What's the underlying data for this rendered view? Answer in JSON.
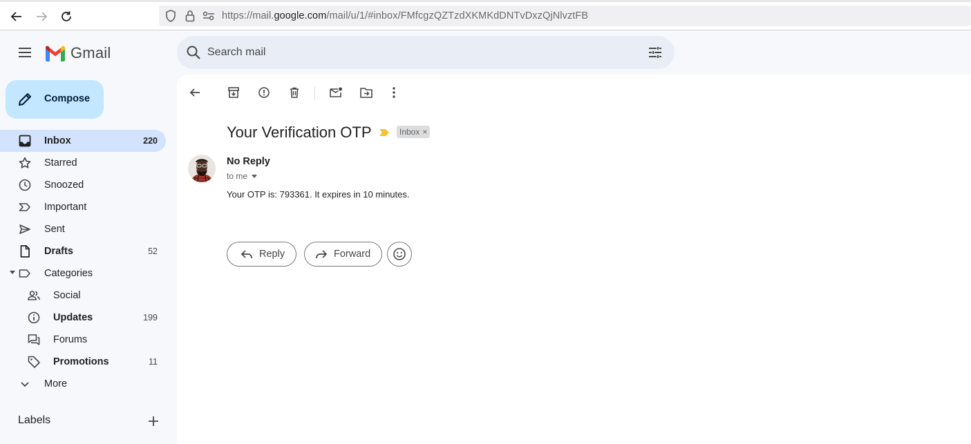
{
  "browser": {
    "url_prefix": "https://mail.",
    "url_host": "google.com",
    "url_path": "/mail/u/1/#inbox/FMfcgzQZTzdXKMKdDNTvDxzQjNlvztFB"
  },
  "app": {
    "name": "Gmail",
    "search_placeholder": "Search mail"
  },
  "sidebar": {
    "compose_label": "Compose",
    "items": [
      {
        "label": "Inbox",
        "count": "220"
      },
      {
        "label": "Starred",
        "count": ""
      },
      {
        "label": "Snoozed",
        "count": ""
      },
      {
        "label": "Important",
        "count": ""
      },
      {
        "label": "Sent",
        "count": ""
      },
      {
        "label": "Drafts",
        "count": "52"
      },
      {
        "label": "Categories",
        "count": ""
      },
      {
        "label": "Social",
        "count": ""
      },
      {
        "label": "Updates",
        "count": "199"
      },
      {
        "label": "Forums",
        "count": ""
      },
      {
        "label": "Promotions",
        "count": "11"
      },
      {
        "label": "More",
        "count": ""
      }
    ],
    "labels_heading": "Labels"
  },
  "email": {
    "subject": "Your Verification OTP",
    "label_chip": "Inbox",
    "label_chip_close": "×",
    "sender": "No Reply",
    "recipient": "to me",
    "body": "Your OTP is: 793361. It expires in 10 minutes."
  },
  "actions": {
    "reply_label": "Reply",
    "forward_label": "Forward"
  },
  "colors": {
    "accent": "#c2e7ff",
    "active_nav": "#d3e3fd",
    "importance_marker": "#f2c230"
  }
}
